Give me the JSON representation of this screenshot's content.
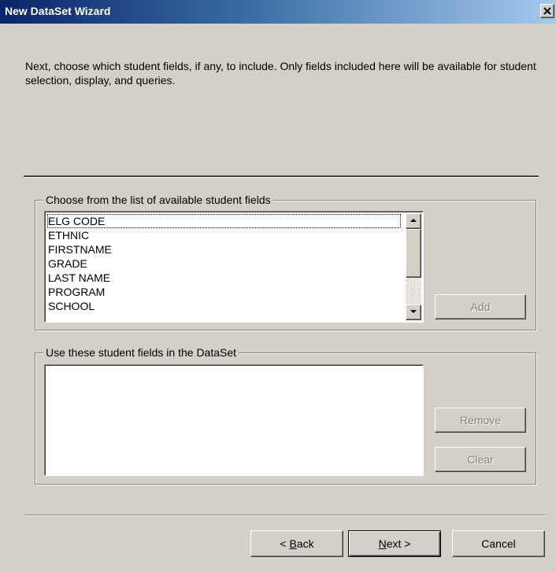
{
  "window": {
    "title": "New DataSet Wizard",
    "close_glyph": "close-icon"
  },
  "intro_text": "Next, choose which student fields, if any, to include.  Only fields included here will be available for student selection, display, and queries.",
  "available_group": {
    "legend": "Choose from the list of available student fields",
    "items": [
      "ELG CODE",
      "ETHNIC",
      "FIRSTNAME",
      "GRADE",
      "LAST NAME",
      "PROGRAM",
      "SCHOOL"
    ],
    "focused_index": 0,
    "add_label": "Add"
  },
  "selected_group": {
    "legend": "Use these student fields in the DataSet",
    "items": [],
    "remove_label": "Remove",
    "clear_label": "Clear"
  },
  "footer": {
    "back_prefix": "< ",
    "back_accel": "B",
    "back_rest": "ack",
    "next_accel": "N",
    "next_rest": "ext >",
    "cancel_label": "Cancel"
  }
}
